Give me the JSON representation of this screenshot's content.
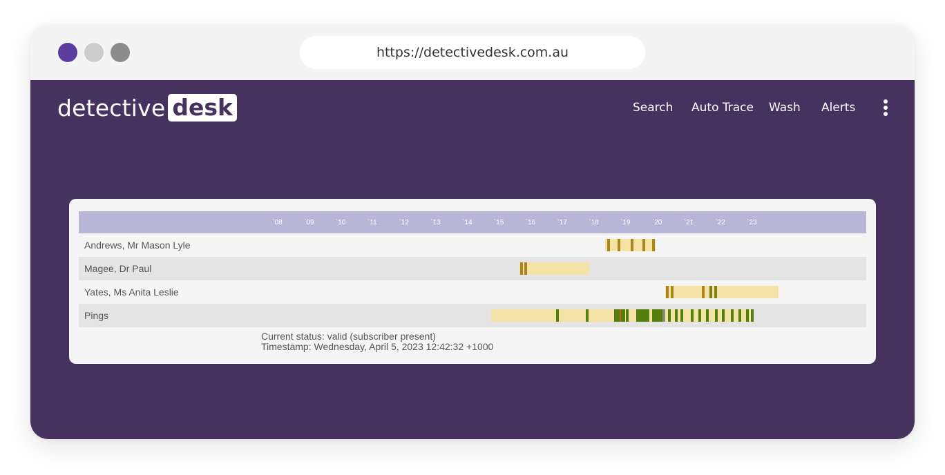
{
  "browser": {
    "url": "https://detectivedesk.com.au",
    "window_dots": [
      "#5b3d9f",
      "#cccccc",
      "#8c8c8c"
    ]
  },
  "site": {
    "logo_left": "detective",
    "logo_right": "desk",
    "nav": [
      "Search",
      "Auto Trace",
      "Wash",
      "Alerts"
    ],
    "menu_icon": "kebab-menu-icon"
  },
  "colors": {
    "page_bg": "#46325f",
    "header_bar": "#b9b5d6",
    "range": "#f5e3a5",
    "mark_brown": "#a7861f",
    "mark_olive": "#7d7e18",
    "mark_green": "#547f0c",
    "mark_grey": "#8b8a7b",
    "mark_orange": "#c05f1e"
  },
  "timeline": {
    "ticks": [
      "`08",
      "`09",
      "`10",
      "`11",
      "`12",
      "`13",
      "`14",
      "`15",
      "`16",
      "`17",
      "`18",
      "`19",
      "`20",
      "`21",
      "`22",
      "`23"
    ],
    "domain": [
      2008,
      2024
    ],
    "rows": [
      {
        "label": "Andrews, Mr Mason Lyle",
        "ranges": [
          [
            2018.37,
            2019.96
          ]
        ],
        "marks": [
          {
            "at": 2018.46,
            "color": "mark_brown"
          },
          {
            "at": 2018.79,
            "color": "mark_brown"
          },
          {
            "at": 2019.21,
            "color": "mark_brown"
          },
          {
            "at": 2019.58,
            "color": "mark_brown"
          },
          {
            "at": 2019.89,
            "color": "mark_brown"
          }
        ]
      },
      {
        "label": "Magee, Dr Paul",
        "ranges": [
          [
            2015.65,
            2017.85
          ]
        ],
        "marks": [
          {
            "at": 2015.72,
            "color": "mark_brown"
          },
          {
            "at": 2015.85,
            "color": "mark_brown"
          }
        ]
      },
      {
        "label": "Yates, Ms Anita Leslie",
        "ranges": [
          [
            2020.25,
            2023.85
          ]
        ],
        "marks": [
          {
            "at": 2020.32,
            "color": "mark_brown"
          },
          {
            "at": 2020.48,
            "color": "mark_brown"
          },
          {
            "at": 2021.46,
            "color": "mark_brown"
          },
          {
            "at": 2021.71,
            "color": "mark_olive"
          },
          {
            "at": 2021.85,
            "color": "mark_olive"
          }
        ]
      },
      {
        "label": "Pings",
        "ranges": [
          [
            2014.75,
            2023.02
          ]
        ],
        "marks": [
          {
            "at": 2016.85,
            "color": "mark_green"
          },
          {
            "at": 2017.8,
            "color": "mark_green"
          },
          {
            "at": 2018.65,
            "color": "mark_green",
            "span": 0.35
          },
          {
            "at": 2018.82,
            "color": "mark_orange",
            "span": 0.05
          },
          {
            "at": 2019.05,
            "color": "mark_green"
          },
          {
            "at": 2019.35,
            "color": "mark_green",
            "span": 0.4
          },
          {
            "at": 2019.85,
            "color": "mark_green",
            "span": 0.35
          },
          {
            "at": 2020.22,
            "color": "mark_grey"
          },
          {
            "at": 2020.4,
            "color": "mark_green"
          },
          {
            "at": 2020.6,
            "color": "mark_green"
          },
          {
            "at": 2020.78,
            "color": "mark_green"
          },
          {
            "at": 2021.12,
            "color": "mark_green"
          },
          {
            "at": 2021.35,
            "color": "mark_green"
          },
          {
            "at": 2021.6,
            "color": "mark_green"
          },
          {
            "at": 2021.87,
            "color": "mark_green"
          },
          {
            "at": 2022.1,
            "color": "mark_green"
          },
          {
            "at": 2022.38,
            "color": "mark_green"
          },
          {
            "at": 2022.62,
            "color": "mark_green"
          },
          {
            "at": 2022.85,
            "color": "mark_green"
          },
          {
            "at": 2023.0,
            "color": "mark_green"
          }
        ]
      }
    ],
    "status_line": "Current status: valid (subscriber present)",
    "timestamp_line": "Timestamp: Wednesday, April 5, 2023 12:42:32 +1000"
  }
}
